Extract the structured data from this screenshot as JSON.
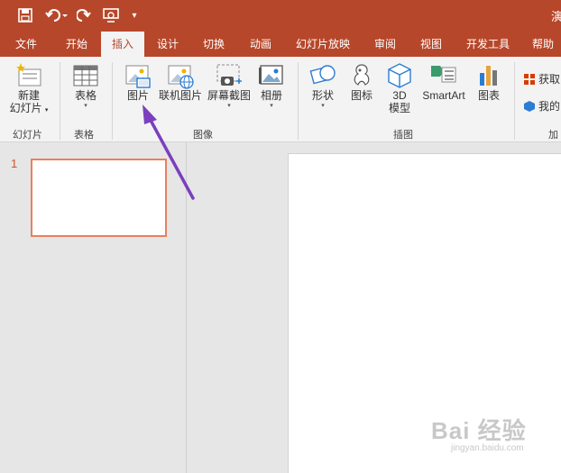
{
  "titlebar": {
    "doc_title": "演",
    "qat": {
      "save_icon": "save-icon",
      "undo_icon": "undo-icon",
      "redo_icon": "redo-icon",
      "present_icon": "present-from-start-icon",
      "customize_icon": "customize-qat-icon"
    }
  },
  "tabs": [
    {
      "label": "文件"
    },
    {
      "label": "开始"
    },
    {
      "label": "插入",
      "active": true
    },
    {
      "label": "设计"
    },
    {
      "label": "切换"
    },
    {
      "label": "动画"
    },
    {
      "label": "幻灯片放映"
    },
    {
      "label": "审阅"
    },
    {
      "label": "视图"
    },
    {
      "label": "开发工具"
    },
    {
      "label": "帮助"
    }
  ],
  "ribbon": {
    "slides_group": {
      "label": "幻灯片",
      "new_slide_line1": "新建",
      "new_slide_line2": "幻灯片"
    },
    "tables_group": {
      "label": "表格",
      "table": "表格"
    },
    "images_group": {
      "label": "图像",
      "picture": "图片",
      "online_picture": "联机图片",
      "screenshot": "屏幕截图",
      "album": "相册"
    },
    "illustrations_group": {
      "label": "插图",
      "shapes": "形状",
      "icons": "图标",
      "model_3d_line1": "3D",
      "model_3d_line2": "模型",
      "smartart": "SmartArt",
      "chart": "图表"
    },
    "addins_group": {
      "label": "加",
      "get_addins": "获取",
      "my_addins": "我的"
    }
  },
  "thumbnails": [
    {
      "number": "1"
    }
  ],
  "watermark": {
    "text": "Bai 经验",
    "sub": "jingyan.baidu.com"
  },
  "colors": {
    "accent": "#b7472a",
    "arrow": "#7b3fbf",
    "thumb_border": "#e8805f"
  }
}
